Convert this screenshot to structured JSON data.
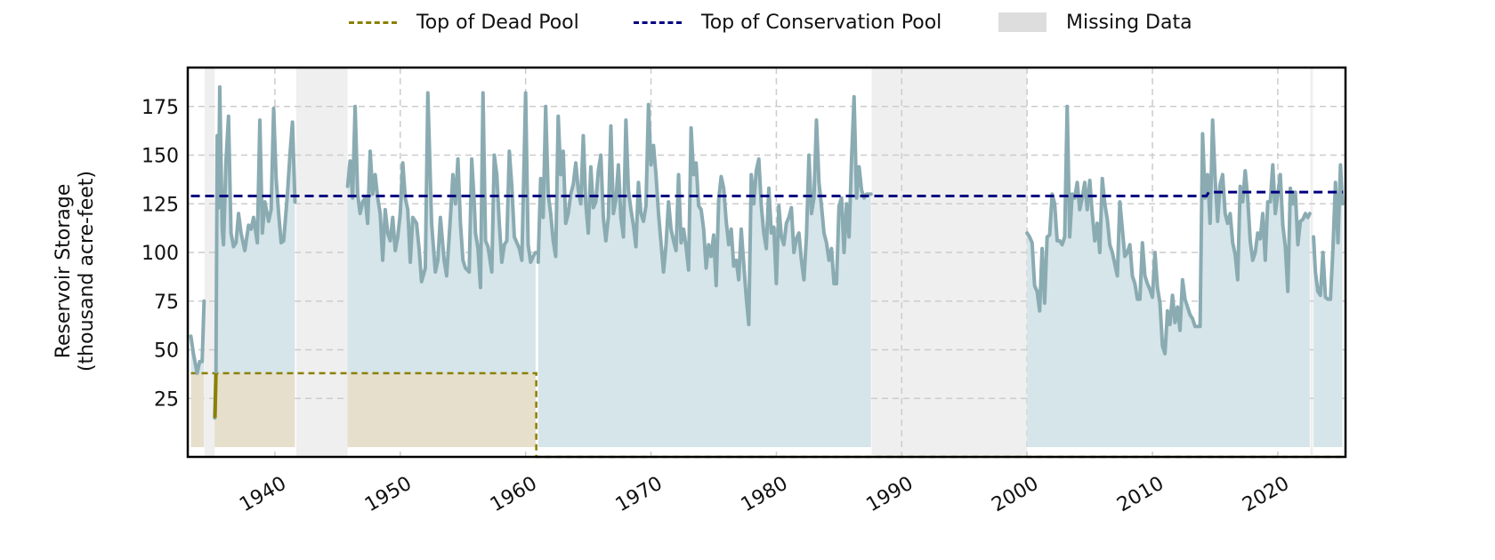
{
  "chart_data": {
    "type": "line",
    "title": "",
    "xlabel": "",
    "ylabel": "Reservoir Storage\n(thousand acre-feet)",
    "ylabel_lines": [
      "Reservoir Storage",
      "(thousand acre-feet)"
    ],
    "xlim": [
      1933.05,
      2025.4
    ],
    "ylim": [
      -5,
      195
    ],
    "grid": true,
    "legend_position": "top-center",
    "x_ticks": [
      1940,
      1950,
      1960,
      1970,
      1980,
      1990,
      2000,
      2010,
      2020
    ],
    "x_tick_labels": [
      "1940",
      "1950",
      "1960",
      "1970",
      "1980",
      "1990",
      "2000",
      "2010",
      "2020"
    ],
    "y_ticks": [
      25,
      50,
      75,
      100,
      125,
      150,
      175
    ],
    "y_tick_labels": [
      "25",
      "50",
      "75",
      "100",
      "125",
      "150",
      "175"
    ],
    "legend": [
      {
        "label": "Top of Dead Pool",
        "style": "dashed-line",
        "color": "#8b8000"
      },
      {
        "label": "Top of Conservation Pool",
        "style": "dashed-line",
        "color": "#000080"
      },
      {
        "label": "Missing Data",
        "style": "box",
        "color": "#dddddd"
      }
    ],
    "colors": {
      "storage_line": "#8aabb2",
      "storage_fill": "#d6e5e9",
      "dead_pool_line": "#8b8000",
      "dead_pool_fill": "#e6dfcc",
      "conservation_line": "#000080",
      "missing_fill": "#efefef",
      "grid": "#cccccc"
    },
    "dead_pool": {
      "value": 38,
      "x_start": 1933.3,
      "x_end": 1960.85
    },
    "conservation_pool": [
      {
        "x_start": 1933.3,
        "x_end": 2014.3,
        "value": 129
      },
      {
        "x_start": 2014.5,
        "x_end": 2025.2,
        "value": 131
      }
    ],
    "missing_data": [
      [
        1934.4,
        1935.2
      ],
      [
        1941.7,
        1945.8
      ],
      [
        1987.6,
        2000.0
      ],
      [
        2022.6,
        2022.8
      ]
    ],
    "series": [
      {
        "name": "Reservoir Storage",
        "segments": [
          {
            "x": [
              1933.3,
              1933.5,
              1933.8,
              1934.0,
              1934.2,
              1934.35
            ],
            "y": [
              57,
              48,
              38,
              44,
              44,
              75
            ]
          },
          {
            "x": [
              1935.2,
              1935.3,
              1935.4,
              1935.5,
              1935.6,
              1935.8,
              1935.9,
              1936.1,
              1936.3,
              1936.5,
              1936.7,
              1936.9,
              1937.1,
              1937.3,
              1937.6,
              1937.9,
              1938.1,
              1938.3,
              1938.6,
              1938.8,
              1939.0,
              1939.2,
              1939.5,
              1939.7,
              1939.9,
              1940.1,
              1940.3,
              1940.5,
              1940.7,
              1941.0,
              1941.2,
              1941.4,
              1941.6
            ],
            "y": [
              15,
              38,
              160,
              123,
              185,
              112,
              104,
              147,
              170,
              110,
              103,
              105,
              120,
              110,
              101,
              114,
              112,
              118,
              105,
              168,
              110,
              126,
              116,
              122,
              174,
              138,
              120,
              105,
              106,
              130,
              150,
              167,
              126
            ]
          },
          {
            "x": [
              1945.8,
              1946.0,
              1946.2,
              1946.4,
              1946.6,
              1946.8,
              1947.0,
              1947.2,
              1947.4,
              1947.6,
              1947.8,
              1948.0,
              1948.2,
              1948.4,
              1948.6,
              1948.8,
              1949.0,
              1949.2,
              1949.4,
              1949.6,
              1949.8,
              1950.0,
              1950.2,
              1950.4,
              1950.6,
              1950.8,
              1951.0,
              1951.3,
              1951.5,
              1951.7,
              1952.0,
              1952.2,
              1952.5,
              1952.8,
              1953.0,
              1953.2,
              1953.5,
              1953.7,
              1954.0,
              1954.2,
              1954.4,
              1954.6,
              1954.8,
              1955.0,
              1955.2,
              1955.5,
              1955.7,
              1955.9,
              1956.0,
              1956.2,
              1956.4,
              1956.6,
              1956.8,
              1957.0,
              1957.3,
              1957.5,
              1957.7,
              1957.9,
              1958.1,
              1958.3,
              1958.5,
              1958.7,
              1958.9,
              1959.1,
              1959.3,
              1959.5,
              1959.7,
              1960.0,
              1960.2,
              1960.4,
              1960.6,
              1960.8
            ],
            "y": [
              134,
              147,
              128,
              175,
              130,
              120,
              126,
              128,
              115,
              152,
              130,
              140,
              128,
              120,
              96,
              122,
              110,
              106,
              118,
              101,
              108,
              120,
              146,
              128,
              122,
              95,
              118,
              115,
              102,
              85,
              92,
              182,
              115,
              90,
              96,
              118,
              96,
              88,
              118,
              140,
              125,
              148,
              115,
              96,
              92,
              90,
              148,
              126,
              110,
              102,
              82,
              182,
              106,
              103,
              90,
              150,
              140,
              115,
              95,
              104,
              106,
              152,
              134,
              108,
              105,
              102,
              96,
              182,
              104,
              95,
              98,
              100
            ]
          },
          {
            "x": [
              1961.0,
              1961.2,
              1961.4,
              1961.6,
              1961.8,
              1962.0,
              1962.2,
              1962.4,
              1962.6,
              1962.8,
              1963.0,
              1963.2,
              1963.4,
              1963.6,
              1963.8,
              1964.0,
              1964.2,
              1964.4,
              1964.6,
              1964.8,
              1965.0,
              1965.2,
              1965.4,
              1965.6,
              1965.8,
              1966.0,
              1966.2,
              1966.4,
              1966.6,
              1966.8,
              1967.0,
              1967.2,
              1967.4,
              1967.6,
              1967.8,
              1968.0,
              1968.2,
              1968.4,
              1968.6,
              1968.8,
              1969.0,
              1969.2,
              1969.4,
              1969.6,
              1969.8,
              1970.0,
              1970.2,
              1970.4,
              1970.6,
              1970.8,
              1971.0,
              1971.2,
              1971.4,
              1971.6,
              1971.8,
              1972.0,
              1972.2,
              1972.4,
              1972.6,
              1972.8,
              1973.0,
              1973.2,
              1973.4,
              1973.6,
              1973.8,
              1974.0,
              1974.2,
              1974.4,
              1974.6,
              1974.8,
              1975.0,
              1975.2,
              1975.4,
              1975.6,
              1975.8,
              1976.0,
              1976.2,
              1976.4,
              1976.6,
              1976.8,
              1977.0,
              1977.2,
              1977.4,
              1977.6,
              1977.8,
              1978.0,
              1978.2,
              1978.4,
              1978.6,
              1978.8,
              1979.0,
              1979.2,
              1979.4,
              1979.6,
              1979.8,
              1980.0,
              1980.2,
              1980.4,
              1980.6,
              1980.8,
              1981.0,
              1981.2,
              1981.4,
              1981.6,
              1981.8,
              1982.0,
              1982.2,
              1982.4,
              1982.6,
              1982.8,
              1983.0,
              1983.2,
              1983.4,
              1983.6,
              1983.8,
              1984.0,
              1984.2,
              1984.4,
              1984.6,
              1984.8,
              1985.0,
              1985.2,
              1985.4,
              1985.6,
              1985.8,
              1986.0,
              1986.2,
              1986.4,
              1986.6,
              1986.8,
              1987.0,
              1987.2,
              1987.4,
              1987.55
            ],
            "y": [
              95,
              138,
              118,
              175,
              130,
              120,
              106,
              98,
              170,
              140,
              152,
              115,
              120,
              130,
              135,
              146,
              132,
              125,
              160,
              125,
              110,
              144,
              123,
              126,
              142,
              150,
              118,
              106,
              118,
              165,
              120,
              127,
              145,
              118,
              108,
              168,
              132,
              122,
              114,
              103,
              136,
              120,
              116,
              124,
              176,
              145,
              155,
              140,
              120,
              105,
              90,
              104,
              126,
              112,
              106,
              101,
              140,
              105,
              112,
              103,
              91,
              164,
              140,
              146,
              124,
              122,
              112,
              92,
              104,
              98,
              109,
              83,
              127,
              139,
              133,
              116,
              104,
              112,
              93,
              96,
              86,
              112,
              94,
              77,
              63,
              140,
              125,
              142,
              148,
              124,
              110,
              102,
              133,
              110,
              113,
              84,
              124,
              108,
              104,
              115,
              118,
              123,
              100,
              107,
              110,
              96,
              86,
              108,
              150,
              120,
              128,
              168,
              136,
              124,
              110,
              105,
              96,
              102,
              84,
              84,
              124,
              128,
              100,
              125,
              108,
              148,
              180,
              128,
              144,
              132,
              128,
              130,
              130,
              130
            ]
          },
          {
            "x": [
              2000.0,
              2000.2,
              2000.4,
              2000.6,
              2000.8,
              2001.0,
              2001.2,
              2001.4,
              2001.6,
              2001.8,
              2002.0,
              2002.2,
              2002.4,
              2002.6,
              2002.8,
              2003.0,
              2003.2,
              2003.4,
              2003.6,
              2003.8,
              2004.0,
              2004.2,
              2004.4,
              2004.6,
              2004.8,
              2005.0,
              2005.2,
              2005.4,
              2005.6,
              2005.8,
              2006.0,
              2006.2,
              2006.4,
              2006.6,
              2006.8,
              2007.0,
              2007.2,
              2007.4,
              2007.6,
              2007.8,
              2008.0,
              2008.2,
              2008.4,
              2008.6,
              2008.8,
              2009.0,
              2009.2,
              2009.4,
              2009.6,
              2009.8,
              2010.0,
              2010.2,
              2010.4,
              2010.6,
              2010.8,
              2011.0,
              2011.2,
              2011.4,
              2011.6,
              2011.8,
              2012.0,
              2012.2,
              2012.4,
              2012.6,
              2012.8,
              2013.0,
              2013.2,
              2013.4,
              2013.6,
              2013.8,
              2014.0,
              2014.2,
              2014.4,
              2014.6,
              2014.8,
              2015.0,
              2015.2,
              2015.4,
              2015.6,
              2015.8,
              2016.0,
              2016.2,
              2016.4,
              2016.6,
              2016.8,
              2017.0,
              2017.2,
              2017.4,
              2017.6,
              2017.8,
              2018.0,
              2018.2,
              2018.4,
              2018.6,
              2018.8,
              2019.0,
              2019.2,
              2019.4,
              2019.6,
              2019.8,
              2020.0,
              2020.2,
              2020.4,
              2020.6,
              2020.8,
              2021.0,
              2021.2,
              2021.4,
              2021.6,
              2021.8,
              2022.0,
              2022.2,
              2022.4,
              2022.55
            ],
            "y": [
              110,
              108,
              105,
              83,
              80,
              70,
              102,
              74,
              108,
              109,
              130,
              125,
              106,
              106,
              104,
              108,
              175,
              108,
              130,
              128,
              136,
              122,
              128,
              136,
              122,
              137,
              120,
              106,
              115,
              100,
              138,
              125,
              117,
              104,
              100,
              94,
              88,
              126,
              112,
              98,
              100,
              104,
              88,
              84,
              76,
              76,
              105,
              88,
              84,
              81,
              77,
              100,
              82,
              74,
              52,
              48,
              70,
              63,
              78,
              64,
              72,
              60,
              86,
              76,
              72,
              68,
              66,
              62,
              62,
              62,
              161,
              128,
              140,
              115,
              168,
              138,
              116,
              135,
              140,
              120,
              115,
              120,
              105,
              99,
              86,
              134,
              126,
              142,
              128,
              106,
              96,
              100,
              110,
              107,
              120,
              96,
              126,
              126,
              145,
              120,
              130,
              140,
              114,
              103,
              80,
              133,
              125,
              131,
              104,
              116,
              117,
              120,
              118,
              120
            ]
          },
          {
            "x": [
              2022.85,
              2023.0,
              2023.2,
              2023.4,
              2023.6,
              2023.8,
              2024.0,
              2024.2,
              2024.4,
              2024.6,
              2024.8,
              2025.0,
              2025.15
            ],
            "y": [
              108,
              90,
              80,
              78,
              100,
              77,
              76,
              76,
              102,
              136,
              105,
              145,
              125
            ]
          }
        ]
      }
    ]
  }
}
